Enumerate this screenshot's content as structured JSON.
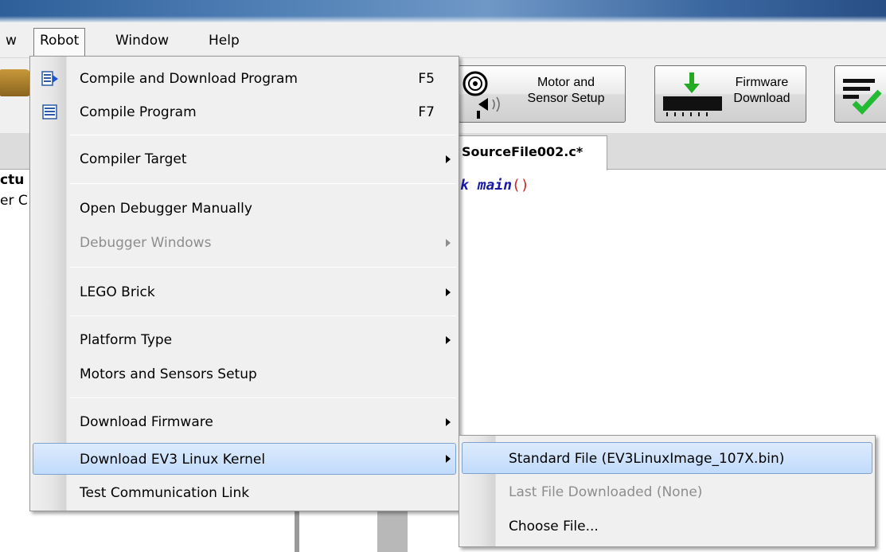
{
  "menubar": {
    "items": [
      {
        "label": "w"
      },
      {
        "label": "Robot"
      },
      {
        "label": "Window"
      },
      {
        "label": "Help"
      }
    ]
  },
  "toolbar": {
    "motor_setup": {
      "line1": "Motor and",
      "line2": "Sensor Setup"
    },
    "firmware": {
      "line1": "Firmware",
      "line2": "Download"
    }
  },
  "editor": {
    "tab_label": "SourceFile002.c*",
    "code_keyword": "k",
    "code_func": "main",
    "code_parens": "()"
  },
  "left_pane": {
    "text1": "ctu",
    "text2": "er C"
  },
  "robot_menu": {
    "items": [
      {
        "label": "Compile and Download Program",
        "shortcut": "F5",
        "icon": "compile-download-icon"
      },
      {
        "label": "Compile Program",
        "shortcut": "F7",
        "icon": "compile-icon"
      },
      {
        "label": "Compiler Target"
      },
      {
        "label": "Open Debugger Manually"
      },
      {
        "label": "Debugger Windows"
      },
      {
        "label": "LEGO Brick"
      },
      {
        "label": "Platform Type"
      },
      {
        "label": "Motors and Sensors Setup"
      },
      {
        "label": "Download Firmware"
      },
      {
        "label": "Download EV3 Linux Kernel"
      },
      {
        "label": "Test Communication Link"
      }
    ]
  },
  "kernel_submenu": {
    "items": [
      {
        "label": "Standard File (EV3LinuxImage_107X.bin)"
      },
      {
        "label": "Last File Downloaded (None)"
      },
      {
        "label": "Choose File..."
      }
    ]
  },
  "colors": {
    "highlight": "#c1dbfc",
    "highlight_border": "#7da2ce",
    "disabled_text": "#8d8d8d",
    "code_blue": "#1a1aaa",
    "code_red": "#cc2222"
  }
}
